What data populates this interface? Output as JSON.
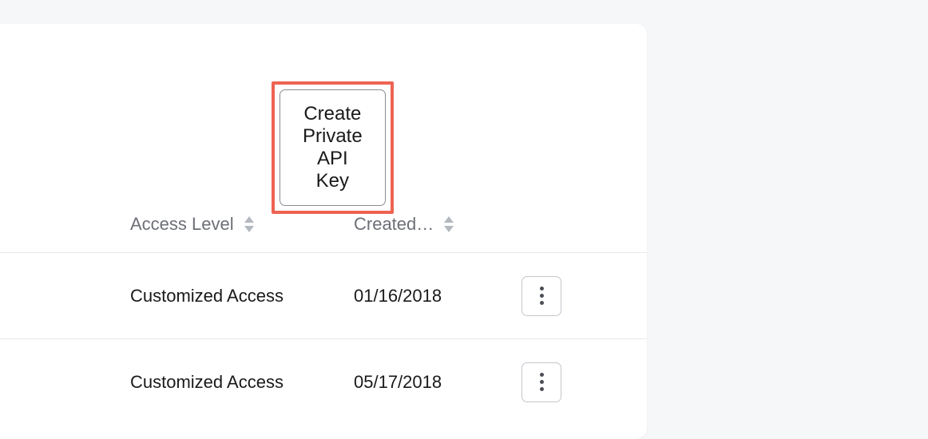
{
  "actions": {
    "create_button_label": "Create Private API Key"
  },
  "table": {
    "columns": {
      "access_level": "Access Level",
      "created": "Created…"
    },
    "rows": [
      {
        "access_level": "Customized Access",
        "created": "01/16/2018"
      },
      {
        "access_level": "Customized Access",
        "created": "05/17/2018"
      }
    ]
  },
  "colors": {
    "highlight": "#ee6352",
    "panel_bg": "#ffffff",
    "page_bg": "#f6f7f9",
    "border": "#e7e9ec",
    "muted_text": "#6c6f76"
  }
}
